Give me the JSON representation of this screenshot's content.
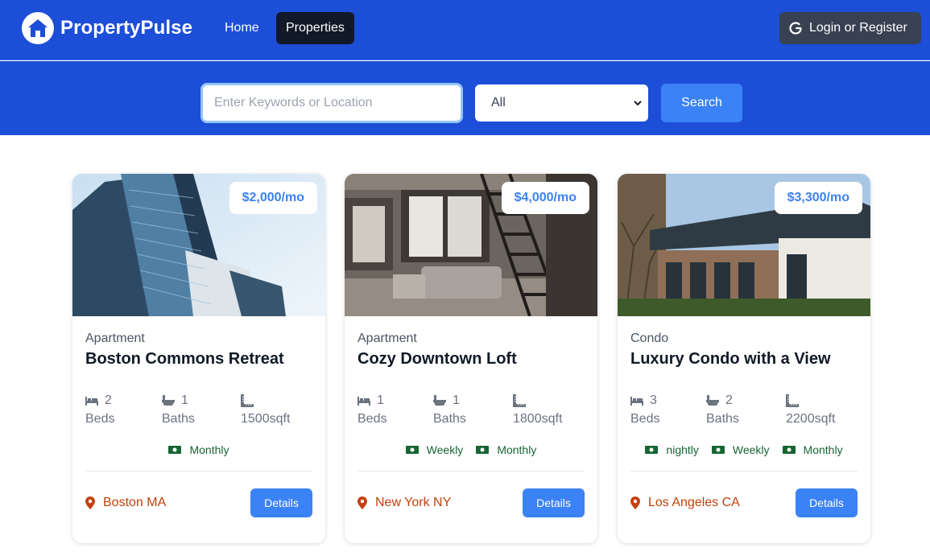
{
  "nav": {
    "brand": "PropertyPulse",
    "links": [
      "Home",
      "Properties"
    ],
    "login": "Login or Register"
  },
  "search": {
    "placeholder": "Enter Keywords or Location",
    "type_selected": "All",
    "button": "Search"
  },
  "details_label": "Details",
  "properties": [
    {
      "price": "$2,000/mo",
      "type": "Apartment",
      "name": "Boston Commons Retreat",
      "beds": "2",
      "beds_label": "Beds",
      "baths": "1",
      "baths_label": "Baths",
      "sqft": "1500sqft",
      "rates": [
        "Monthly"
      ],
      "location": "Boston MA"
    },
    {
      "price": "$4,000/mo",
      "type": "Apartment",
      "name": "Cozy Downtown Loft",
      "beds": "1",
      "beds_label": "Beds",
      "baths": "1",
      "baths_label": "Baths",
      "sqft": "1800sqft",
      "rates": [
        "Weekly",
        "Monthly"
      ],
      "location": "New York NY"
    },
    {
      "price": "$3,300/mo",
      "type": "Condo",
      "name": "Luxury Condo with a View",
      "beds": "3",
      "beds_label": "Beds",
      "baths": "2",
      "baths_label": "Baths",
      "sqft": "2200sqft",
      "rates": [
        "nightly",
        "Weekly",
        "Monthly"
      ],
      "location": "Los Angeles CA"
    }
  ],
  "colors": {
    "brand_blue": "#1d4ed8",
    "accent_blue": "#3b82f6",
    "location_orange": "#c2410c",
    "rate_green": "#166534"
  }
}
